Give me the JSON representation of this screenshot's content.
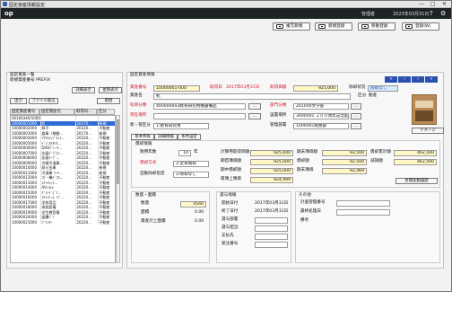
{
  "window": {
    "title": "固定資産情報設定",
    "minimize": "—",
    "maximize": "□",
    "close": "✕"
  },
  "appbar": {
    "logo": "op",
    "user": "管理者",
    "date": "2023年03月31日"
  },
  "toolbar": [
    {
      "label": "複写新規"
    },
    {
      "label": "新規登録"
    },
    {
      "label": "移動登録"
    },
    {
      "label": "登録(W)"
    }
  ],
  "list": {
    "title": "固定資産一覧",
    "filter_text": "新規資産番号 PREFIX",
    "detail_label": "詳細表示",
    "sort_label": "並替表示",
    "output_label": "出力",
    "file_label": "ファイル取込",
    "refresh_label": "取替",
    "headers": [
      "固定資産番号",
      "固定資産名",
      "取得日...",
      "区分"
    ],
    "rows": [
      [
        "00100340/1000",
        "",
        "",
        ""
      ],
      [
        "10000001000",
        "机",
        "20170...",
        "新規"
      ],
      [
        "10000002000",
        "椅子",
        "20220...",
        "不動産"
      ],
      [
        "10000003000",
        "倉庫（移動...",
        "20170...",
        "新規"
      ],
      [
        "10000004000",
        "ｱｸﾘﾙｼｯﾌﾟﾈｯﾄ...",
        "20220...",
        "不動産"
      ],
      [
        "10000005000",
        "ﾃﾞｼﾞﾀﾙｻｲﾈ...",
        "20220...",
        "不動産"
      ],
      [
        "10000006000",
        "DVDﾌﾟﾚｰﾔ...",
        "20220...",
        "不動産"
      ],
      [
        "10000007000",
        "応接ﾃﾞﾌﾟﾛﾝ...",
        "20220...",
        "不動産"
      ],
      [
        "10000008000",
        "応接ﾃｰﾌﾞ...",
        "20220...",
        "不動産"
      ],
      [
        "10000009000",
        "冷蔵冷凍庫...",
        "20220...",
        "不動産"
      ],
      [
        "10000010000",
        "耐火金庫",
        "20220...",
        "新規"
      ],
      [
        "10000011000",
        "冷凍庫 ﾘｰﾁ...",
        "20220...",
        "新規"
      ],
      [
        "10000012000",
        "ｺﾋﾟｰ機ﾃﾞﾌﾛ...",
        "20220...",
        "不動産"
      ],
      [
        "10000013000",
        "ｽﾁｰﾙﾗｯｸ...",
        "20220...",
        "不動産"
      ],
      [
        "10000014000",
        "AVｼｽﾃﾑ",
        "20220...",
        "不動産"
      ],
      [
        "10000015000",
        "ｸﾞﾗﾝﾄﾞﾋﾟｱ...",
        "20220...",
        "不動産"
      ],
      [
        "10000016000",
        "ｱﾙﾐﾌﾚｰﾑ（ﾍﾟ...",
        "20220...",
        "不動産"
      ],
      [
        "10000017000",
        "学校用品",
        "20220...",
        "不動産"
      ],
      [
        "10000018000",
        "高校設備",
        "20220...",
        "不動産"
      ],
      [
        "10000019000",
        "学生教室備",
        "20220...",
        "不動産"
      ],
      [
        "10000020000",
        "図書ﾊﾟｿ",
        "20220...",
        "不動産"
      ],
      [
        "10000021000",
        "ﾌﾟﾘﾝﾀｰ",
        "20220...",
        "不動産"
      ]
    ]
  },
  "detail": {
    "title": "固定資産情報",
    "nav": [
      "«",
      "‹",
      "›",
      "»"
    ],
    "asset_no_label": "資産番号",
    "asset_no": "10000001-000",
    "acq_label": "取得日",
    "acq_date": "2017年03月31日",
    "acq_price_label": "取得価額",
    "acq_price": "925,000",
    "status_label": "除却状況",
    "status_value": "除却なし",
    "asset_name_label": "資産名",
    "asset_name": "机",
    "class_label": "区分",
    "class_value": "動産",
    "account_label": "科目分類",
    "account_value": "400000003教育研究用機器備品",
    "dept_label": "部門分類",
    "dept_value": "201000文学部",
    "place_label": "設置場所",
    "place_value": "3000001 １００周年記念館",
    "location_label": "現在場所",
    "related_label": "新・管区分",
    "related_value": "1:教育研究用",
    "mgmt_label": "管理部署",
    "mgmt_value": "1000001総務部",
    "image_button": "イメージ",
    "tabs": [
      "基本情報",
      "詳細情報",
      "条件設定"
    ],
    "dep": {
      "title": "償却情報",
      "life_label": "耐用年数",
      "life_value": "10",
      "life_unit": "年",
      "method_label": "償却方式",
      "method_value": "2:定率償却",
      "auto_label": "自動除却指定",
      "auto_value": "2:除却なし",
      "calc_base_label": "計算用取得価額",
      "calc_base": "925,000",
      "base_label": "基準価額",
      "begin_book_label": "期首簿価額",
      "begin_book": "925,000",
      "acc_label": "期末簿価額",
      "acc_value": "92,500",
      "period_dep_label": "期中償却額",
      "period_dep": "925,000",
      "dep_amt_label": "償却額",
      "dep_amt": "92,500",
      "end_label": "期末簿価",
      "end_value": "92,469",
      "book_label": "帳簿上簿価",
      "book_value": "924,999",
      "total_dep_label": "償却累計額",
      "total_dep": "462,500",
      "reserve_label": "減損額",
      "reserve": "462,500",
      "history_button": "金額変動履歴"
    },
    "qty": {
      "title": "数量・面積",
      "qty_label": "数量",
      "qty_value": "4540",
      "ext_label": "面積",
      "ext_value": "0.00",
      "use_label": "資産計上面積",
      "use_value": "0.00"
    },
    "lease": {
      "title": "貸与情報",
      "start_label": "開始日付",
      "start_value": "2017年03月31日",
      "end_label": "終了日付",
      "end_value": "2017年03月31日",
      "dept_label": "貸与部署",
      "person_label": "貸与担当",
      "payer_label": "支払先",
      "place_label": "発注番号"
    },
    "other": {
      "title": "その他",
      "plan_label": "計画管理番号",
      "code_label": "最終処理日",
      "note_label": "備考"
    }
  }
}
